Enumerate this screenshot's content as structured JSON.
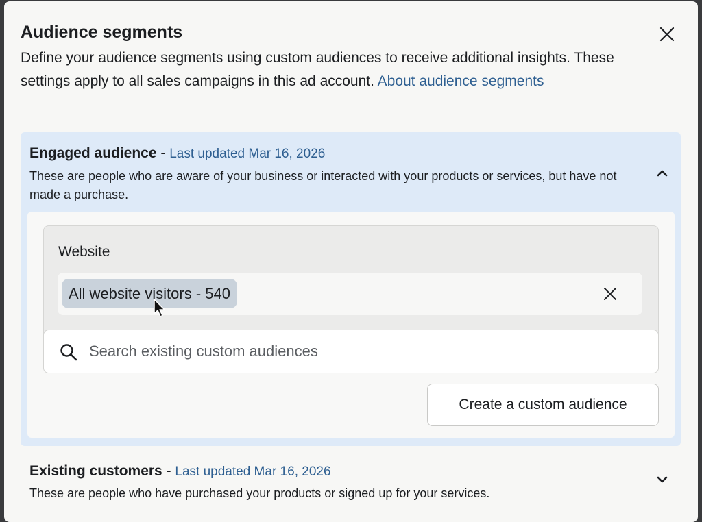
{
  "dialog": {
    "title": "Audience segments",
    "description": "Define your audience segments using custom audiences to receive additional insights. These settings apply to all sales campaigns in this ad account. ",
    "link_label": "About audience segments",
    "close_icon": "close-icon"
  },
  "engaged": {
    "name": "Engaged audience",
    "separator": " - ",
    "updated": "Last updated Mar 16, 2026",
    "description": "These are people who are aware of your business or interacted with your products or services, but have not made a purchase.",
    "expanded": true,
    "website_label": "Website",
    "selected_chip": "All website visitors - 540",
    "search_placeholder": "Search existing custom audiences",
    "create_button": "Create a custom audience"
  },
  "existing": {
    "name": "Existing customers",
    "separator": " - ",
    "updated": "Last updated Mar 16, 2026",
    "description": "These are people who have purchased your products or signed up for your services.",
    "expanded": false
  },
  "colors": {
    "accent_link": "#2e5f91",
    "section_bg": "#deeaf8",
    "chip_bg": "#c9d2db"
  }
}
